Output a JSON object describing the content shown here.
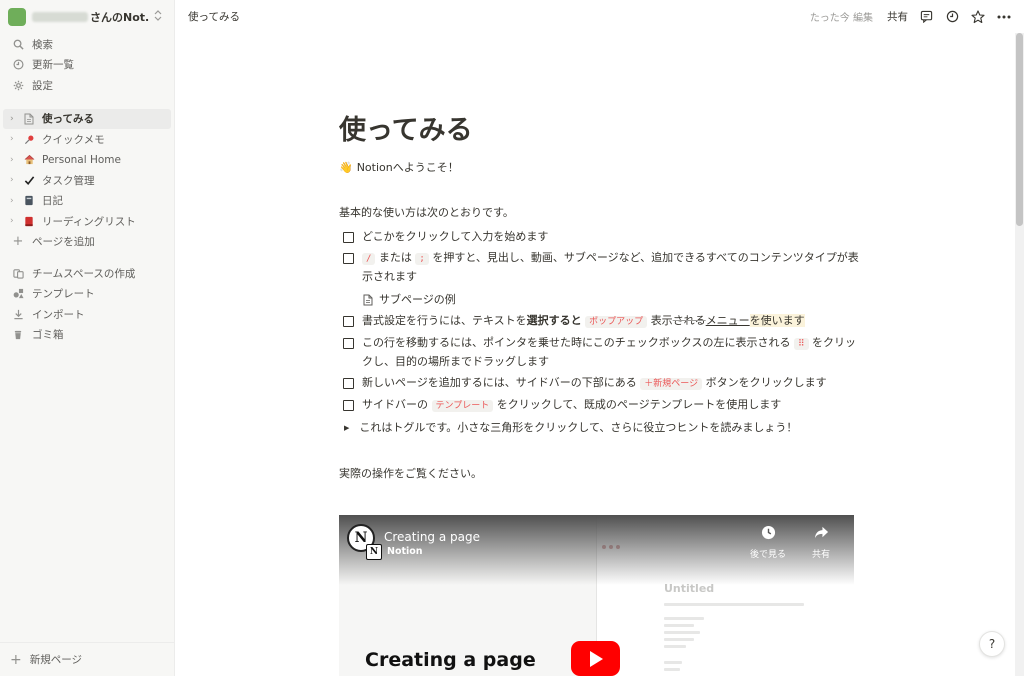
{
  "sidebar": {
    "workspace": {
      "name": "さんのNot...",
      "switch_icon": "updown-chevron-icon"
    },
    "nav": [
      {
        "label": "検索",
        "icon": "search-icon"
      },
      {
        "label": "更新一覧",
        "icon": "clock-icon"
      },
      {
        "label": "設定",
        "icon": "gear-icon"
      }
    ],
    "pages": [
      {
        "label": "使ってみる",
        "icon": "page-icon",
        "active": true
      },
      {
        "label": "クイックメモ",
        "icon": "pushpin-icon"
      },
      {
        "label": "Personal Home",
        "icon": "house-icon"
      },
      {
        "label": "タスク管理",
        "icon": "checkmark-icon"
      },
      {
        "label": "日記",
        "icon": "notebook-icon"
      },
      {
        "label": "リーディングリスト",
        "icon": "book-icon"
      }
    ],
    "add_page": "ページを追加",
    "tools": [
      {
        "label": "チームスペースの作成",
        "icon": "team-icon"
      },
      {
        "label": "テンプレート",
        "icon": "shapes-icon"
      },
      {
        "label": "インポート",
        "icon": "import-icon"
      },
      {
        "label": "ゴミ箱",
        "icon": "trash-icon"
      }
    ],
    "new_page": "新規ページ"
  },
  "topbar": {
    "breadcrumb": "使ってみる",
    "edited": "たった今 編集",
    "share": "共有",
    "icons": [
      "comment-icon",
      "history-icon",
      "star-icon",
      "more-icon"
    ]
  },
  "page": {
    "title": "使ってみる",
    "subtitle_emoji": "👋",
    "subtitle": "Notionへようこそ！",
    "intro": "基本的な使い方は次のとおりです。",
    "todos": {
      "t1": "どこかをクリックして入力を始めます",
      "t2_code1": "/",
      "t2_mid": "または",
      "t2_code2": ";",
      "t2_rest": "を押すと、見出し、動画、サブページなど、追加できるすべてのコンテンツタイプが表示されます",
      "subpage": "サブページの例",
      "t3_a": "書式設定を行うには、テキストを",
      "t3_bold": "選択すると",
      "t3_popup": "ポップアップ",
      "t3_b": "表示",
      "t3_c": "される",
      "t3_d": "メニュー",
      "t3_e": "を使います",
      "t4_a": "この行を移動するには、ポインタを乗せた時にこのチェックボックスの左に表示される",
      "t4_code": "⠿",
      "t4_b": "をクリックし、目的の場所までドラッグします",
      "t5_a": "新しいページを追加するには、サイドバーの下部にある",
      "t5_code": "＋新規ページ",
      "t5_b": "ボタンをクリックします",
      "t6_a": "サイドバーの",
      "t6_code": "テンプレート",
      "t6_b": "をクリックして、既成のページテンプレートを使用します"
    },
    "toggle": "これはトグルです。小さな三角形をクリックして、さらに役立つヒントを読みましょう！",
    "outro": "実際の操作をご覧ください。"
  },
  "video": {
    "title": "Creating a page",
    "channel": "Notion",
    "watch_later": "後で見る",
    "share": "共有",
    "big_title": "Creating a page",
    "mini_untitled": "Untitled"
  },
  "help": "?",
  "colors": {
    "accent_red": "#eb5757",
    "sidebar_bg": "#f7f7f5",
    "text": "#37352f"
  }
}
